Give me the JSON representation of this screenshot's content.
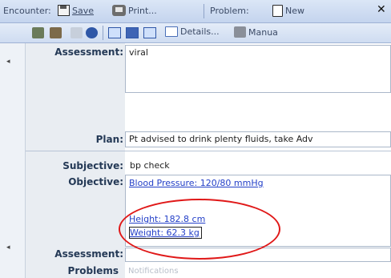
{
  "toolbar_top": {
    "encounter_label": "Encounter:",
    "save_label": "Save",
    "print_label": "Print...",
    "problem_label": "Problem:",
    "new_label": "New"
  },
  "toolbar_second": {
    "details_label": "Details...",
    "manual_label": "Manua"
  },
  "form": {
    "assessment_label": "Assessment:",
    "assessment_value": "viral",
    "plan_label": "Plan:",
    "plan_value": "Pt advised to drink plenty fluids, take Adv",
    "subjective_label": "Subjective:",
    "subjective_value": "bp check",
    "objective_label": "Objective:",
    "bp_link": "Blood Pressure: 120/80 mmHg",
    "height_link": "Height: 182.8 cm",
    "weight_link": "Weight: 62.3 kg",
    "assessment2_label": "Assessment:",
    "problems_label": "Problems",
    "notifications_label": "Notifications"
  },
  "colors": {
    "highlight_oval": "#e01818",
    "link": "#2440c8",
    "label": "#243956"
  }
}
